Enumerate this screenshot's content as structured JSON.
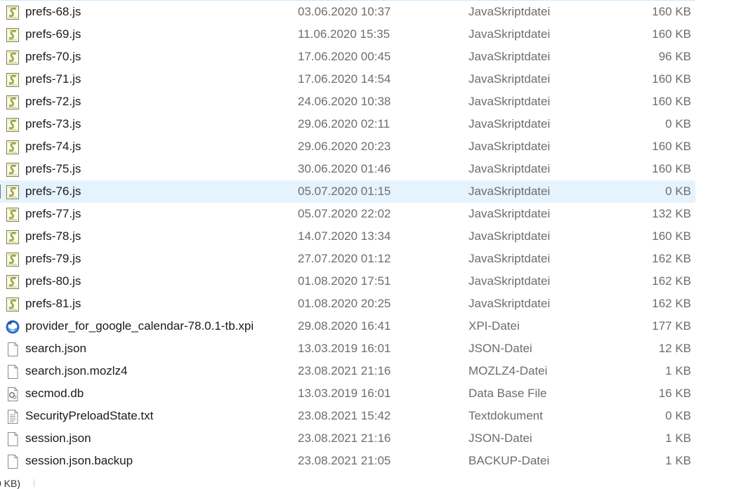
{
  "files": [
    {
      "name": "prefs-68.js",
      "date": "03.06.2020 10:37",
      "type": "JavaSkriptdatei",
      "size": "160 KB",
      "icon": "js-script-icon"
    },
    {
      "name": "prefs-69.js",
      "date": "11.06.2020 15:35",
      "type": "JavaSkriptdatei",
      "size": "160 KB",
      "icon": "js-script-icon"
    },
    {
      "name": "prefs-70.js",
      "date": "17.06.2020 00:45",
      "type": "JavaSkriptdatei",
      "size": "96 KB",
      "icon": "js-script-icon"
    },
    {
      "name": "prefs-71.js",
      "date": "17.06.2020 14:54",
      "type": "JavaSkriptdatei",
      "size": "160 KB",
      "icon": "js-script-icon"
    },
    {
      "name": "prefs-72.js",
      "date": "24.06.2020 10:38",
      "type": "JavaSkriptdatei",
      "size": "160 KB",
      "icon": "js-script-icon"
    },
    {
      "name": "prefs-73.js",
      "date": "29.06.2020 02:11",
      "type": "JavaSkriptdatei",
      "size": "0 KB",
      "icon": "js-script-icon"
    },
    {
      "name": "prefs-74.js",
      "date": "29.06.2020 20:23",
      "type": "JavaSkriptdatei",
      "size": "160 KB",
      "icon": "js-script-icon"
    },
    {
      "name": "prefs-75.js",
      "date": "30.06.2020 01:46",
      "type": "JavaSkriptdatei",
      "size": "160 KB",
      "icon": "js-script-icon"
    },
    {
      "name": "prefs-76.js",
      "date": "05.07.2020 01:15",
      "type": "JavaSkriptdatei",
      "size": "0 KB",
      "icon": "js-script-icon",
      "selected": true
    },
    {
      "name": "prefs-77.js",
      "date": "05.07.2020 22:02",
      "type": "JavaSkriptdatei",
      "size": "132 KB",
      "icon": "js-script-icon"
    },
    {
      "name": "prefs-78.js",
      "date": "14.07.2020 13:34",
      "type": "JavaSkriptdatei",
      "size": "160 KB",
      "icon": "js-script-icon"
    },
    {
      "name": "prefs-79.js",
      "date": "27.07.2020 01:12",
      "type": "JavaSkriptdatei",
      "size": "162 KB",
      "icon": "js-script-icon"
    },
    {
      "name": "prefs-80.js",
      "date": "01.08.2020 17:51",
      "type": "JavaSkriptdatei",
      "size": "162 KB",
      "icon": "js-script-icon"
    },
    {
      "name": "prefs-81.js",
      "date": "01.08.2020 20:25",
      "type": "JavaSkriptdatei",
      "size": "162 KB",
      "icon": "js-script-icon"
    },
    {
      "name": "provider_for_google_calendar-78.0.1-tb.xpi",
      "date": "29.08.2020 16:41",
      "type": "XPI-Datei",
      "size": "177 KB",
      "icon": "thunderbird-icon"
    },
    {
      "name": "search.json",
      "date": "13.03.2019 16:01",
      "type": "JSON-Datei",
      "size": "12 KB",
      "icon": "blank-file-icon"
    },
    {
      "name": "search.json.mozlz4",
      "date": "23.08.2021 21:16",
      "type": "MOZLZ4-Datei",
      "size": "1 KB",
      "icon": "blank-file-icon"
    },
    {
      "name": "secmod.db",
      "date": "13.03.2019 16:01",
      "type": "Data Base File",
      "size": "16 KB",
      "icon": "database-file-icon"
    },
    {
      "name": "SecurityPreloadState.txt",
      "date": "23.08.2021 15:42",
      "type": "Textdokument",
      "size": "0 KB",
      "icon": "text-file-icon"
    },
    {
      "name": "session.json",
      "date": "23.08.2021 21:16",
      "type": "JSON-Datei",
      "size": "1 KB",
      "icon": "blank-file-icon"
    },
    {
      "name": "session.json.backup",
      "date": "23.08.2021 21:05",
      "type": "BACKUP-Datei",
      "size": "1 KB",
      "icon": "blank-file-icon"
    }
  ],
  "status": {
    "text": "0 KB)"
  },
  "colors": {
    "selection": "#e5f3ff",
    "secondary_text": "#6d6d6d",
    "primary_text": "#1a1a1a"
  }
}
